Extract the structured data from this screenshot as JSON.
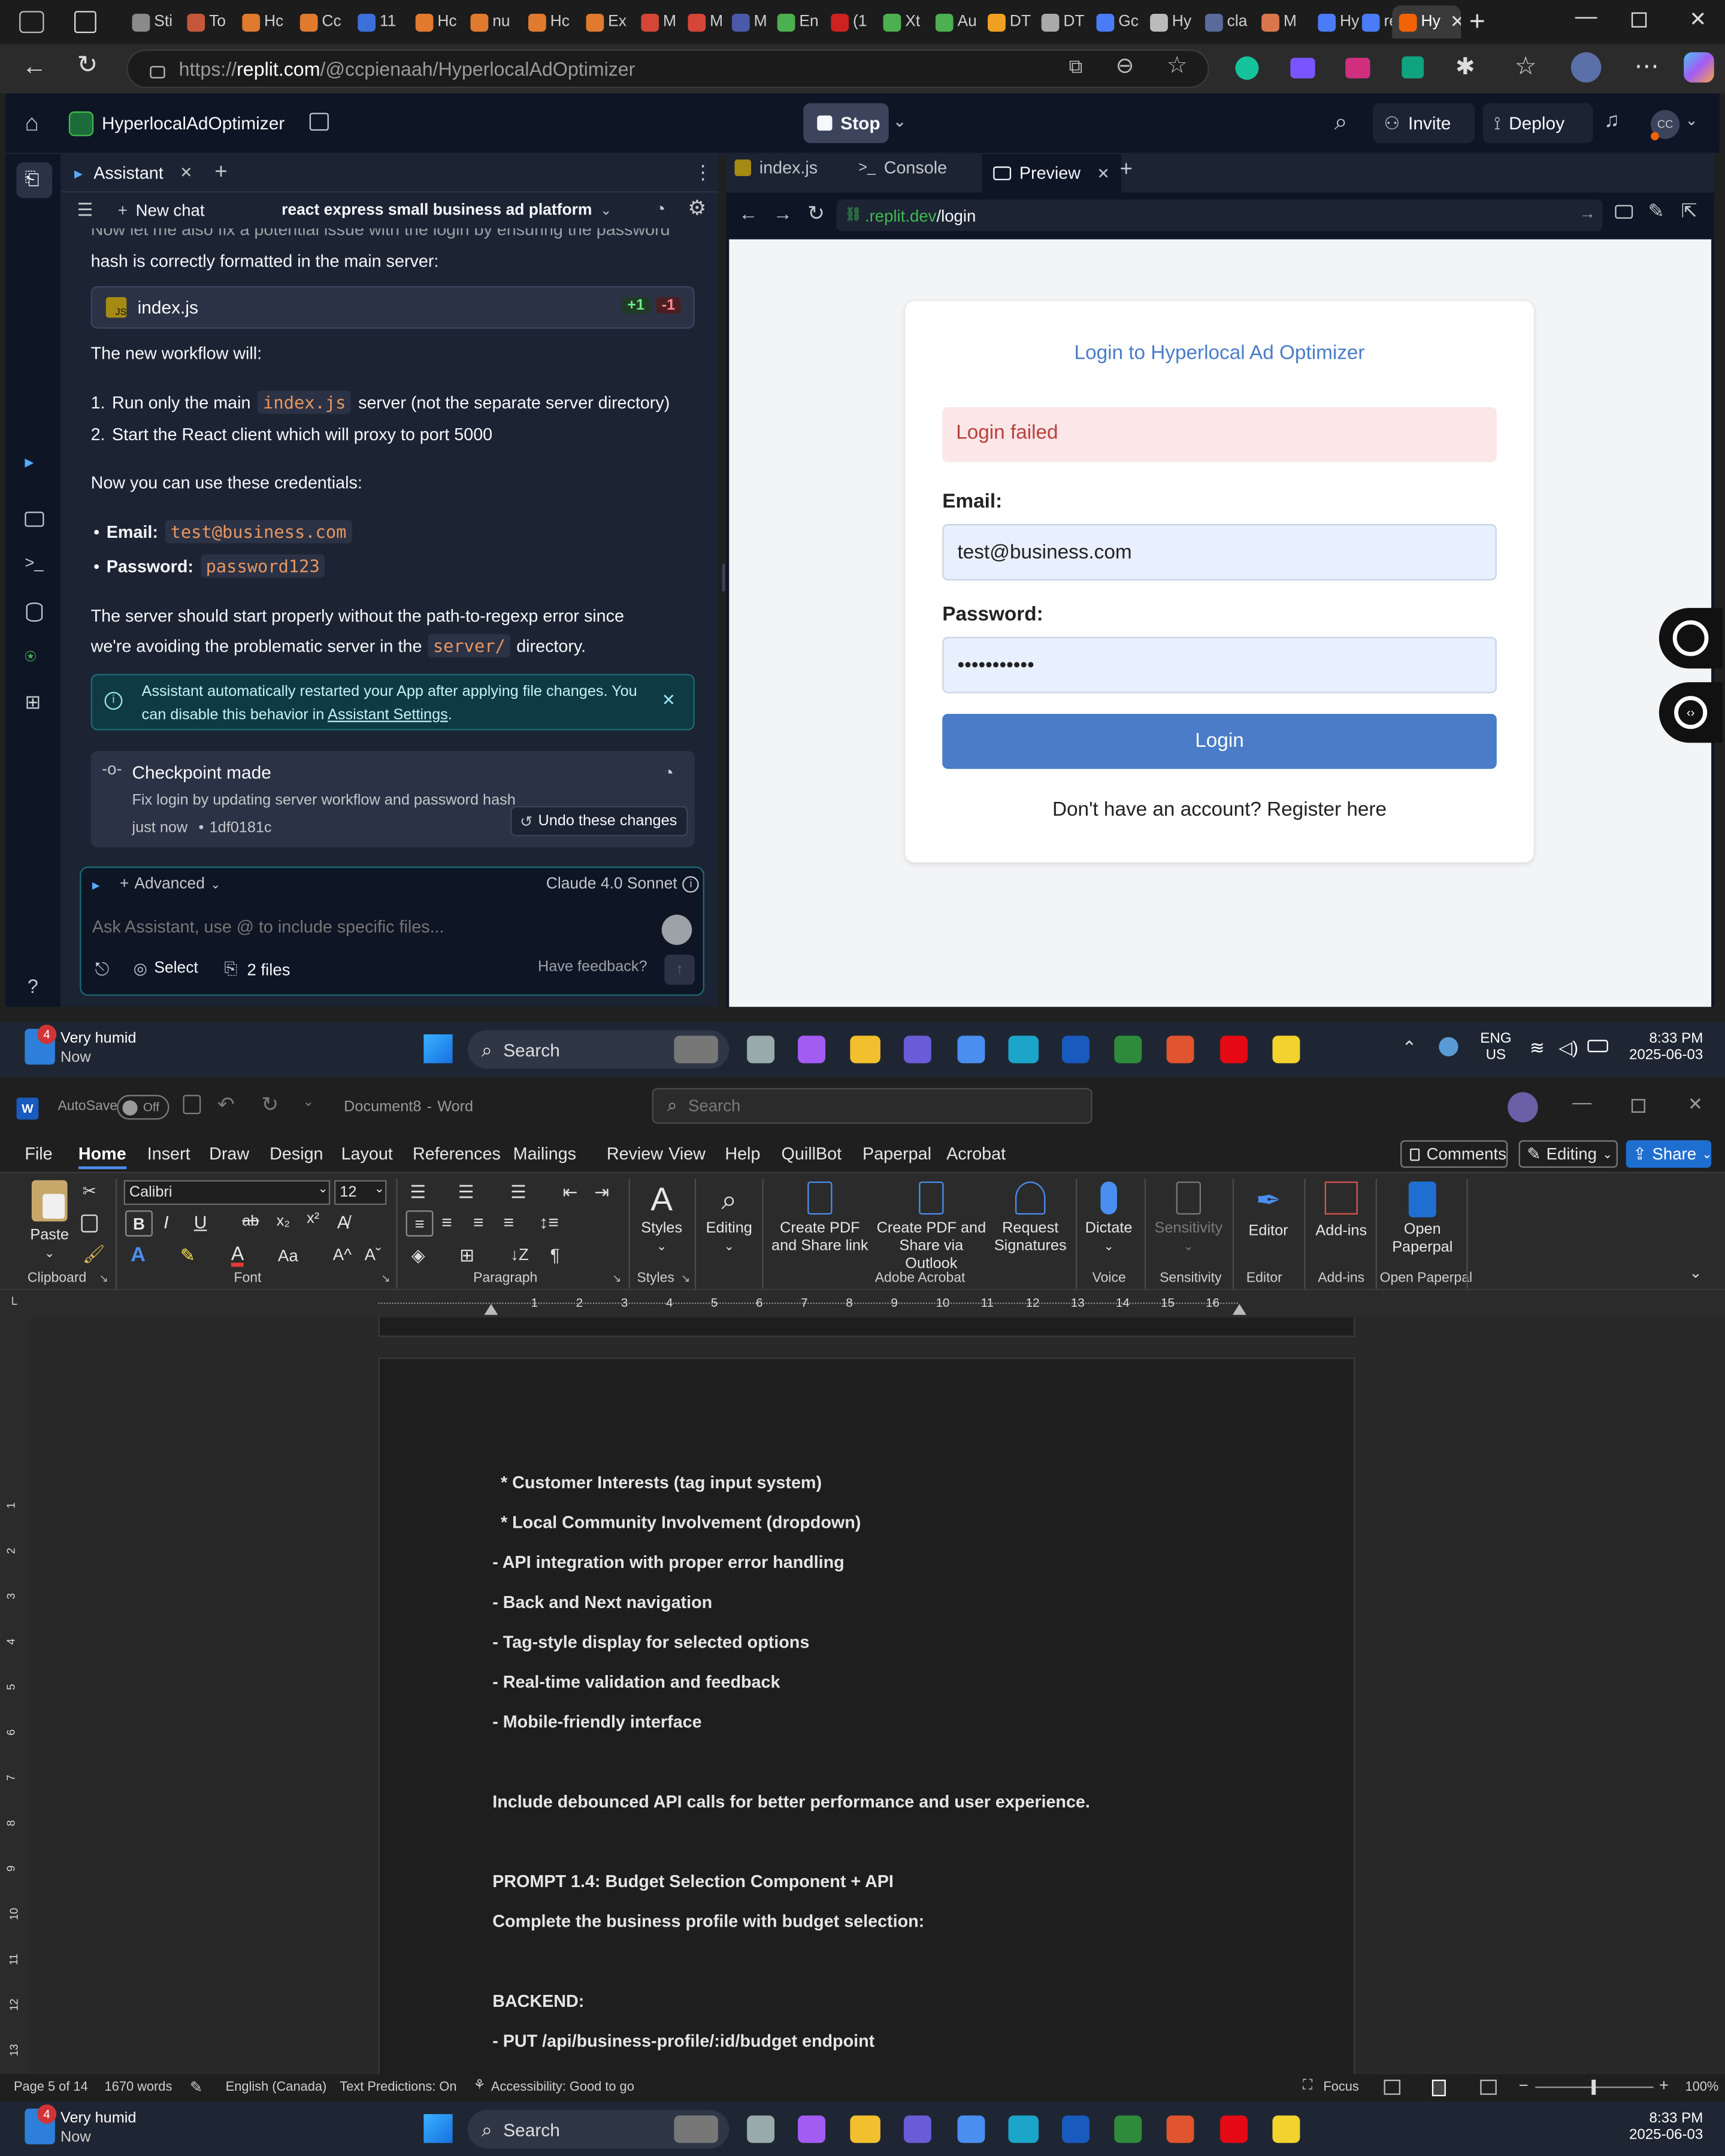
{
  "browser": {
    "tabs": [
      {
        "label": "Sti",
        "color": "#8a8a8a"
      },
      {
        "label": "To",
        "color": "#c4573b"
      },
      {
        "label": "Hc",
        "color": "#e07a2f"
      },
      {
        "label": "Cc",
        "color": "#e07a2f"
      },
      {
        "label": "11",
        "color": "#3c6fd8"
      },
      {
        "label": "Hc",
        "color": "#e07a2f"
      },
      {
        "label": "nu",
        "color": "#e07a2f"
      },
      {
        "label": "Hc",
        "color": "#e07a2f"
      },
      {
        "label": "Ex",
        "color": "#e07a2f"
      },
      {
        "label": "M",
        "color": "#d44638"
      },
      {
        "label": "M",
        "color": "#d44638"
      },
      {
        "label": "M",
        "color": "#4a5aa8"
      },
      {
        "label": "En",
        "color": "#4caf50"
      },
      {
        "label": "(1",
        "color": "#cc2222"
      },
      {
        "label": "Xt",
        "color": "#4caf50"
      },
      {
        "label": "Au",
        "color": "#4caf50"
      },
      {
        "label": "DT",
        "color": "#f0a020"
      },
      {
        "label": "DT",
        "color": "#aaaaaa"
      },
      {
        "label": "Gc",
        "color": "#4a7cf7"
      },
      {
        "label": "Hy",
        "color": "#bbbbbb"
      },
      {
        "label": "cla",
        "color": "#5a6a9a"
      },
      {
        "label": "M",
        "color": "#d9774b"
      },
      {
        "label": "Hy",
        "color": "#4a7cf7"
      },
      {
        "label": "re",
        "color": "#4a7cf7"
      },
      {
        "label": "Hy",
        "color": "#f26207"
      }
    ],
    "url_prefix": "https://",
    "url_host": "replit.com",
    "url_path": "/@ccpienaah/HyperlocalAdOptimizer"
  },
  "replit": {
    "project_name": "HyperlocalAdOptimizer",
    "stop_label": "Stop",
    "invite_label": "Invite",
    "deploy_label": "Deploy",
    "avatar_initials": "CC",
    "assistant_tab": "Assistant",
    "new_chat": "New chat",
    "chat_title": "react express small business ad platform",
    "messages": {
      "cut_line1": "Now let me also fix a potential issue with the login by ensuring the password",
      "cut_line2": "hash is correctly formatted in the main server:",
      "file_name": "index.js",
      "diff_add": "+1",
      "diff_del": "-1",
      "workflow_intro": "The new workflow will:",
      "step1_num": "1.",
      "step1_a": "Run only the main",
      "step1_code": "index.js",
      "step1_b": "server (not the separate server directory)",
      "step2_num": "2.",
      "step2": "Start the React client which will proxy to port 5000",
      "creds_intro": "Now you can use these credentials:",
      "email_label": "Email:",
      "email_value": "test@business.com",
      "password_label": "Password:",
      "password_value": "password123",
      "server_line1": "The server should start properly without the path-to-regexp error since",
      "server_line2a": "we're avoiding the problematic server in the",
      "server_code": "server/",
      "server_line2b": "directory.",
      "notice_line1": "Assistant automatically restarted your App after applying file changes. You",
      "notice_line2a": "can disable this behavior in",
      "notice_link": "Assistant Settings",
      "notice_line2b": ".",
      "checkpoint_title": "Checkpoint made",
      "checkpoint_desc": "Fix login by updating server workflow and password hash",
      "checkpoint_time": "just now",
      "checkpoint_hash": "1df0181c",
      "undo_label": "Undo these changes"
    },
    "composer": {
      "advanced_label": "Advanced",
      "model_label": "Claude 4.0 Sonnet",
      "placeholder": "Ask Assistant, use @ to include specific files...",
      "select_label": "Select",
      "files_label": "2 files",
      "feedback_label": "Have feedback?"
    },
    "right_tabs": {
      "file": "index.js",
      "console": "Console",
      "preview": "Preview"
    },
    "preview_url_host": ".replit.dev",
    "preview_url_path": "/login",
    "login": {
      "title": "Login to Hyperlocal Ad Optimizer",
      "error": "Login failed",
      "email_label": "Email:",
      "email_value": "test@business.com",
      "password_label": "Password:",
      "password_value": "•••••••••••",
      "button": "Login",
      "register": "Don't have an account? Register here"
    }
  },
  "taskbar": {
    "weather_badge": "4",
    "weather_title": "Very humid",
    "weather_sub": "Now",
    "search": "Search",
    "lang": "ENG",
    "region": "US",
    "time": "8:33 PM",
    "date": "2025-06-03"
  },
  "word": {
    "autosave": "AutoSave",
    "autosave_state": "Off",
    "doc_title": "Document8",
    "app_name": "Word",
    "search": "Search",
    "menu": [
      "File",
      "Home",
      "Insert",
      "Draw",
      "Design",
      "Layout",
      "References",
      "Mailings",
      "Review",
      "View",
      "Help",
      "QuillBot",
      "Paperpal",
      "Acrobat"
    ],
    "comments": "Comments",
    "editing": "Editing",
    "share": "Share",
    "font_name": "Calibri",
    "font_size": "12",
    "groups": {
      "clipboard": "Clipboard",
      "font": "Font",
      "paragraph": "Paragraph",
      "styles": "Styles",
      "acrobat": "Adobe Acrobat",
      "voice": "Voice",
      "sensitivity": "Sensitivity",
      "editor": "Editor",
      "addins": "Add-ins",
      "paperpal": "Open Paperpal"
    },
    "buttons": {
      "paste": "Paste",
      "styles": "Styles",
      "editing": "Editing",
      "pdf_share1": "Create PDF",
      "pdf_share2": "and Share link",
      "pdf_outlook1": "Create PDF and",
      "pdf_outlook2": "Share via Outlook",
      "sig1": "Request",
      "sig2": "Signatures",
      "dictate": "Dictate",
      "sensitivity": "Sensitivity",
      "editor": "Editor",
      "addins": "Add-ins",
      "paperpal1": "Open",
      "paperpal2": "Paperpal"
    },
    "ruler_marks": [
      "1",
      "2",
      "3",
      "4",
      "5",
      "6",
      "7",
      "8",
      "9",
      "10",
      "11",
      "12",
      "13",
      "14",
      "15",
      "16"
    ],
    "vruler_marks": [
      "1",
      "2",
      "3",
      "4",
      "5",
      "6",
      "7",
      "8",
      "9",
      "10",
      "11",
      "12",
      "13"
    ],
    "doc_lines": [
      "  * Customer Interests (tag input system)",
      "  * Local Community Involvement (dropdown)",
      "- API integration with proper error handling",
      "- Back and Next navigation",
      "- Tag-style display for selected options",
      "- Real-time validation and feedback",
      "- Mobile-friendly interface",
      "",
      "Include debounced API calls for better performance and user experience.",
      "",
      "PROMPT 1.4: Budget Selection Component + API",
      "Complete the business profile with budget selection:",
      "",
      "BACKEND:",
      "- PUT /api/business-profile/:id/budget endpoint"
    ],
    "status": {
      "page": "Page 5 of 14",
      "words": "1670 words",
      "language": "English (Canada)",
      "predictions": "Text Predictions: On",
      "accessibility": "Accessibility: Good to go",
      "focus": "Focus",
      "zoom": "100%"
    }
  }
}
